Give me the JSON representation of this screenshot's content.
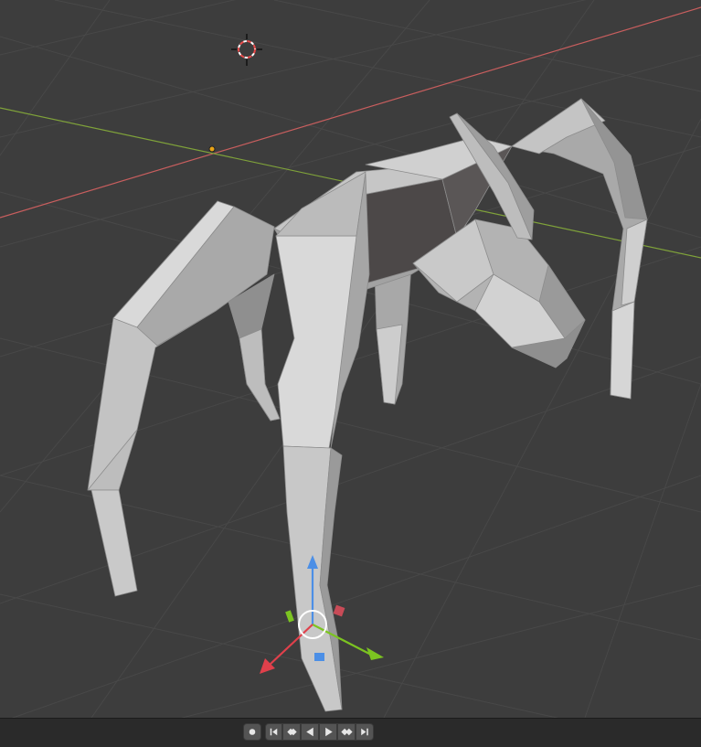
{
  "app": "Blender",
  "viewport": {
    "background": "#3d3d3d",
    "grid_color": "#484848",
    "x_axis_color": "#c85e5e",
    "y_axis_color": "#7fa23a",
    "mesh_color": "#b8b8b8",
    "gizmo": {
      "x_color": "#e0404b",
      "y_color": "#7cc421",
      "z_color": "#4c8fe6"
    }
  },
  "timeline": {
    "buttons": [
      {
        "name": "record-button",
        "icon": "record-icon"
      },
      {
        "name": "jump-to-start-button",
        "icon": "jump-start-icon"
      },
      {
        "name": "prev-keyframe-button",
        "icon": "prev-keyframe-icon"
      },
      {
        "name": "play-reverse-button",
        "icon": "play-reverse-icon"
      },
      {
        "name": "play-button",
        "icon": "play-icon"
      },
      {
        "name": "next-keyframe-button",
        "icon": "next-keyframe-icon"
      },
      {
        "name": "jump-to-end-button",
        "icon": "jump-end-icon"
      }
    ]
  }
}
